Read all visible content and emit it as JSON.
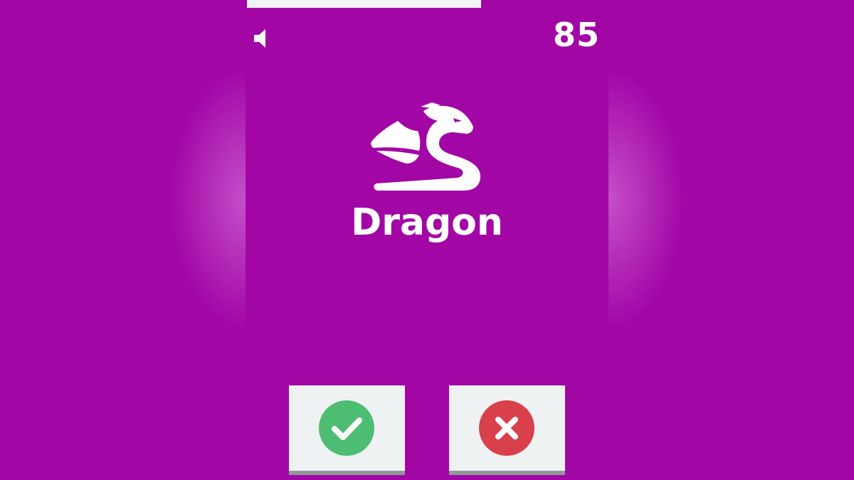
{
  "game": {
    "score": "85",
    "card": {
      "word": "Dragon",
      "icon": "dragon-icon"
    },
    "sound_icon": "speaker-icon",
    "buttons": {
      "correct_icon": "checkmark-icon",
      "wrong_icon": "x-icon"
    }
  },
  "colors": {
    "background": "#a207a6",
    "button_face": "#eef2f2",
    "correct": "#4dbd74",
    "wrong": "#d8404b",
    "text": "#ffffff"
  }
}
